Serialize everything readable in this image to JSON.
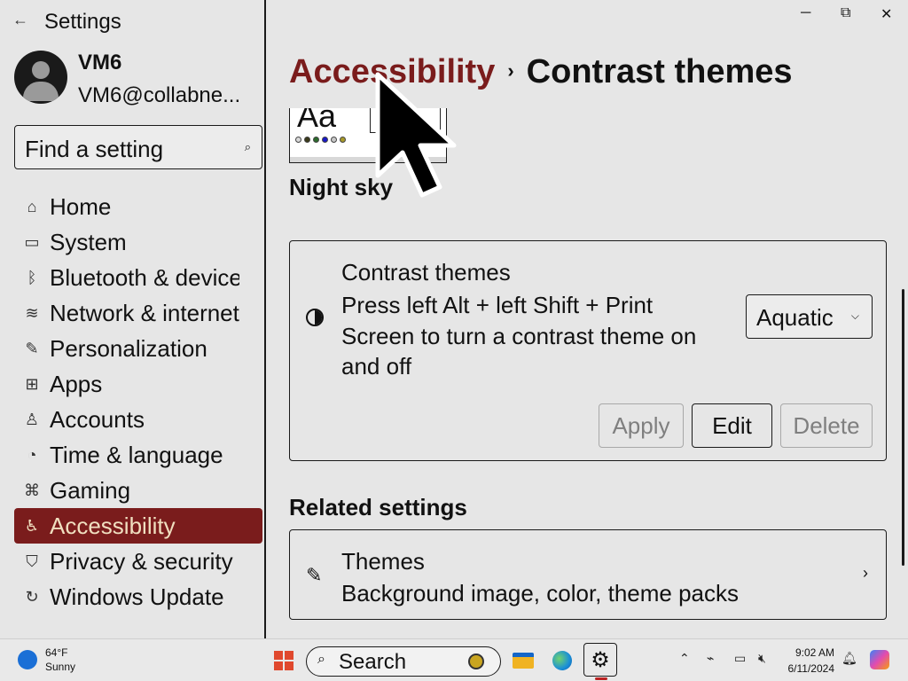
{
  "window": {
    "app_title": "Settings",
    "back_icon": "back-arrow-icon",
    "minimize": "─",
    "restore": "⧉",
    "close": "✕"
  },
  "user": {
    "name": "VM6",
    "email": "VM6@collabne..."
  },
  "search": {
    "placeholder": "Find a setting",
    "icon": "search-icon"
  },
  "sidebar": {
    "items": [
      {
        "label": "Home",
        "icon": "home-icon",
        "glyph": "⌂"
      },
      {
        "label": "System",
        "icon": "monitor-icon",
        "glyph": "▭"
      },
      {
        "label": "Bluetooth & devices",
        "icon": "bluetooth-icon",
        "glyph": "ᛒ"
      },
      {
        "label": "Network & internet",
        "icon": "wifi-icon",
        "glyph": "≋"
      },
      {
        "label": "Personalization",
        "icon": "brush-icon",
        "glyph": "✎"
      },
      {
        "label": "Apps",
        "icon": "apps-icon",
        "glyph": "⊞"
      },
      {
        "label": "Accounts",
        "icon": "person-icon",
        "glyph": "♙"
      },
      {
        "label": "Time & language",
        "icon": "clock-language-icon",
        "glyph": "◔"
      },
      {
        "label": "Gaming",
        "icon": "gamepad-icon",
        "glyph": "⌘"
      },
      {
        "label": "Accessibility",
        "icon": "accessibility-icon",
        "glyph": "♿",
        "selected": true
      },
      {
        "label": "Privacy & security",
        "icon": "shield-icon",
        "glyph": "⛉"
      },
      {
        "label": "Windows Update",
        "icon": "update-icon",
        "glyph": "↻"
      }
    ]
  },
  "breadcrumb": {
    "parent": "Accessibility",
    "separator": "›",
    "current": "Contrast themes"
  },
  "preview": {
    "sample_text": "Aa",
    "theme_name": "Night sky",
    "dot_colors": [
      "#d9d9d9",
      "#3a3a1a",
      "#2c6b2c",
      "#1818c8",
      "#c8c8c8",
      "#a89a2a"
    ]
  },
  "contrast_card": {
    "title": "Contrast themes",
    "description": "Press left Alt + left Shift + Print Screen to turn a contrast theme on and off",
    "selected_theme": "Aquatic",
    "apply_label": "Apply",
    "edit_label": "Edit",
    "delete_label": "Delete"
  },
  "related": {
    "heading": "Related settings",
    "themes_title": "Themes",
    "themes_subtitle": "Background image, color, theme packs"
  },
  "taskbar": {
    "weather_temp": "64°F",
    "weather_desc": "Sunny",
    "search_label": "Search",
    "time": "9:02 AM",
    "date": "6/11/2024"
  },
  "colors": {
    "accent": "#7a1c1c",
    "accent_text": "#f0dfc0",
    "background": "#e6e6e6",
    "border": "#1a1a1a"
  }
}
